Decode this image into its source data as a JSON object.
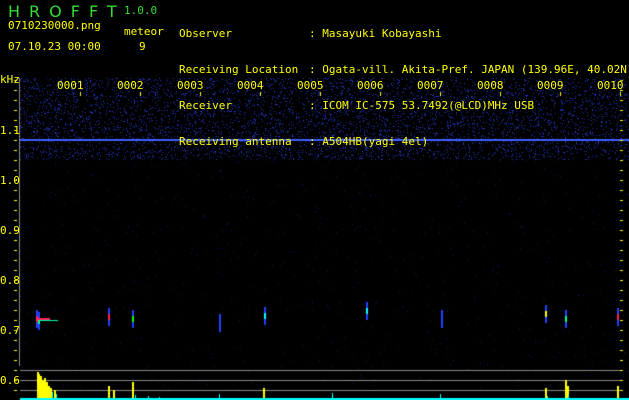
{
  "app": {
    "title": "HROFFT",
    "version": "1.0.0"
  },
  "file": {
    "name": "0710230000.png",
    "datetime": "07.10.23 00:00"
  },
  "meteor": {
    "label": "meteor",
    "count": "9"
  },
  "info": [
    {
      "label": "Observer",
      "value": "Masayuki Kobayashi"
    },
    {
      "label": "Receiving Location",
      "value": "Ogata-vill. Akita-Pref. JAPAN (139.96E, 40.02N)"
    },
    {
      "label": "Receiver",
      "value": "ICOM IC-575 53.7492(@LCD)MHz USB"
    },
    {
      "label": "Receiving antenna",
      "value": "A504HB(yagi 4el)"
    }
  ],
  "axis": {
    "unit": "kHz",
    "ticks": [
      "1.1",
      "1.0",
      "0.9",
      "0.8",
      "0.7",
      "0.6"
    ]
  },
  "columns": [
    "0001",
    "0002",
    "0003",
    "0004",
    "0005",
    "0006",
    "0007",
    "0008",
    "0009",
    "0010"
  ],
  "colors": {
    "text": "#ffff00",
    "title": "#33dd33",
    "noise": "#2030c0",
    "carrier": "#4060ff",
    "histogram": "#ffff00",
    "baseline": "#00ffff"
  }
}
